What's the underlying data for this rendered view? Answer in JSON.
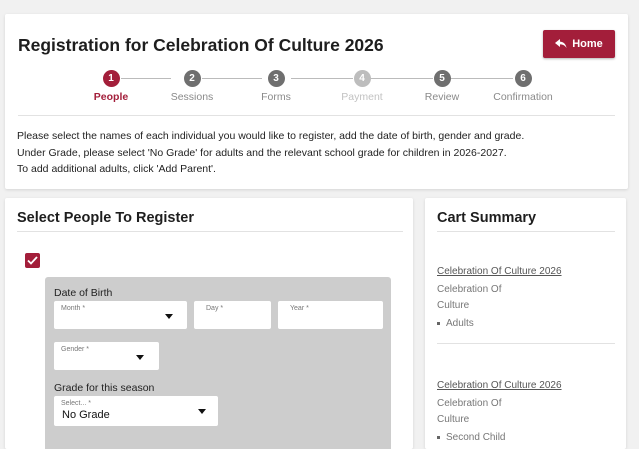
{
  "header": {
    "title": "Registration for Celebration Of Culture 2026",
    "home_label": "Home"
  },
  "stepper": [
    {
      "num": "1",
      "label": "People",
      "state": "active"
    },
    {
      "num": "2",
      "label": "Sessions",
      "state": "normal"
    },
    {
      "num": "3",
      "label": "Forms",
      "state": "normal"
    },
    {
      "num": "4",
      "label": "Payment",
      "state": "disabled"
    },
    {
      "num": "5",
      "label": "Review",
      "state": "normal"
    },
    {
      "num": "6",
      "label": "Confirmation",
      "state": "normal"
    }
  ],
  "instructions": [
    "Please select the names of each individual you would like to register, add the date of birth, gender and grade.",
    "Under Grade, please select 'No Grade' for adults and the relevant school grade for children in 2026-2027.",
    "To add additional adults, click 'Add Parent'."
  ],
  "people": {
    "title": "Select People To Register",
    "dob_label": "Date of Birth",
    "month_placeholder": "Month *",
    "day_placeholder": "Day *",
    "year_placeholder": "Year *",
    "gender_placeholder": "Gender *",
    "grade_label": "Grade for this season",
    "grade_placeholder": "Select... *",
    "grade_value": "No Grade"
  },
  "cart": {
    "title": "Cart Summary",
    "items": [
      {
        "event": "Celebration Of Culture 2026",
        "line1": "Celebration Of",
        "line2": "Culture",
        "bullet": "Adults"
      },
      {
        "event": "Celebration Of Culture 2026",
        "line1": "Celebration Of",
        "line2": "Culture",
        "bullet": "Second Child"
      }
    ]
  },
  "colors": {
    "accent": "#a31e3a",
    "panel": "#cdcdcd"
  }
}
